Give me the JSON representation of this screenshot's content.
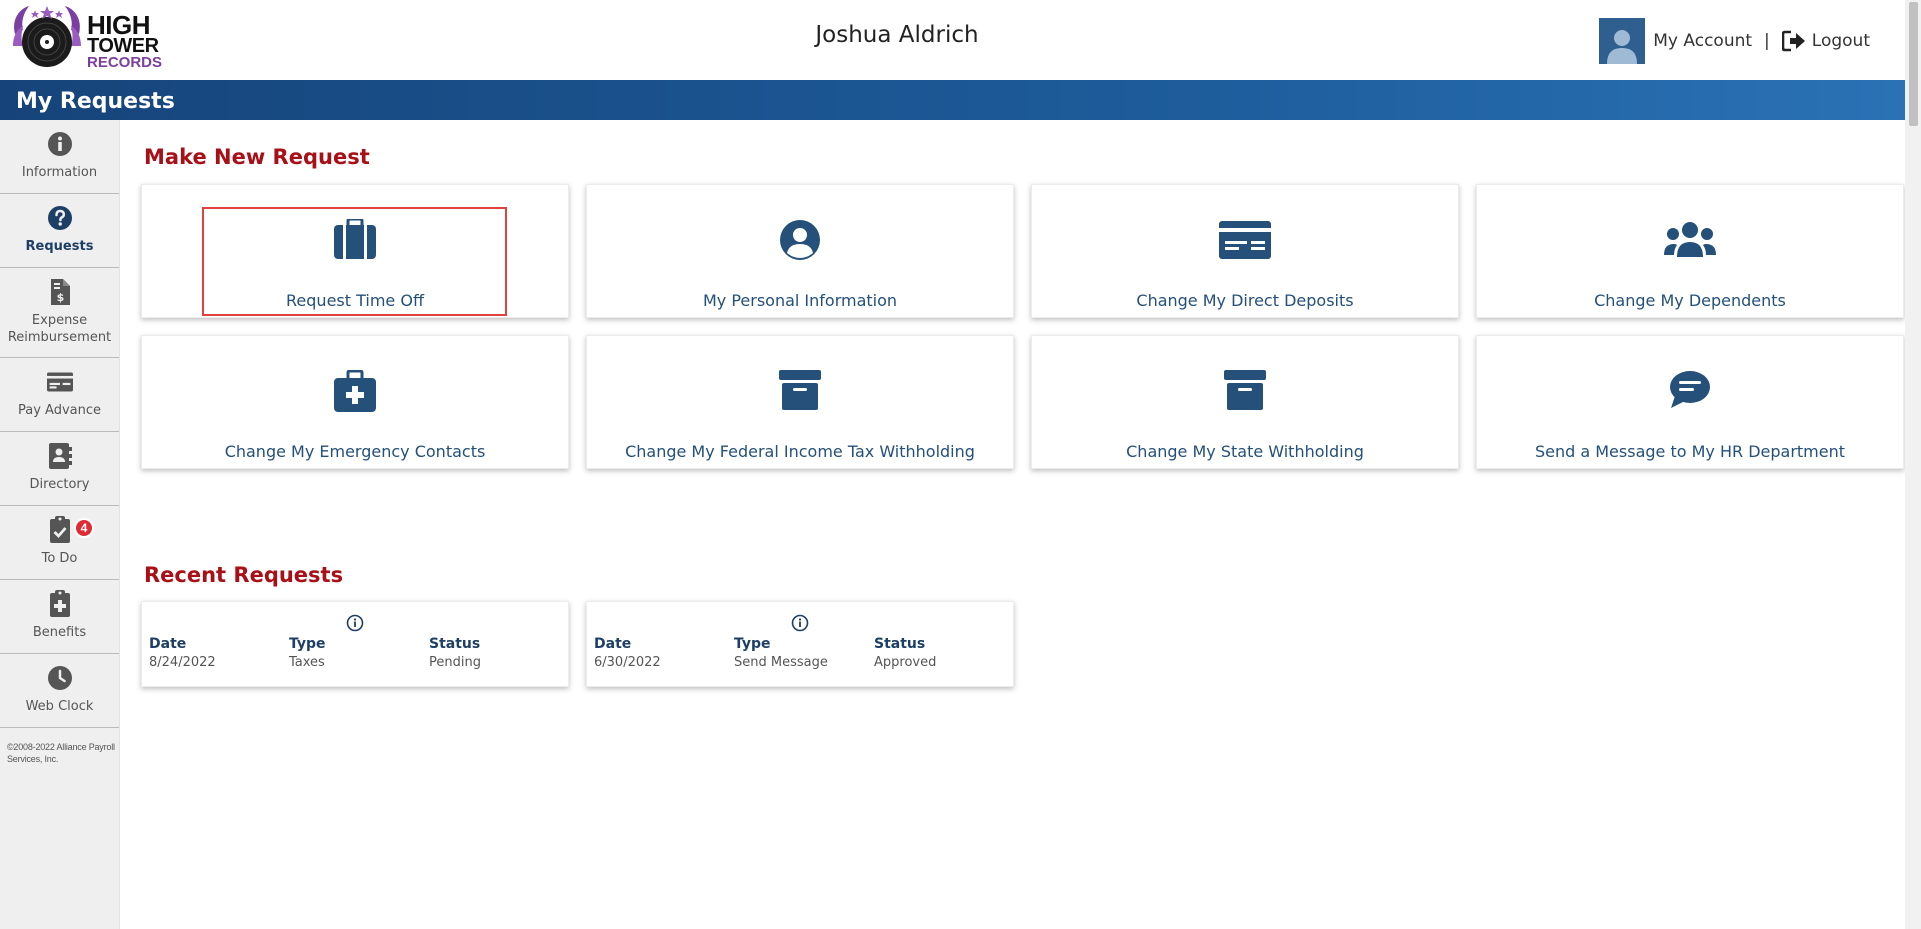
{
  "brand": {
    "line1": "HIGH",
    "line2": "TOWER",
    "line3": "RECORDS",
    "accent": "#7a3fa0"
  },
  "header": {
    "user_name": "Joshua Aldrich",
    "my_account": "My Account",
    "separator": "|",
    "logout": "Logout"
  },
  "page_title": "My Requests",
  "sidebar": {
    "items": [
      {
        "label": "Information",
        "icon": "info-circle-icon"
      },
      {
        "label": "Requests",
        "icon": "question-circle-icon",
        "active": true
      },
      {
        "label": "Expense Reimbursement",
        "icon": "invoice-dollar-icon"
      },
      {
        "label": "Pay Advance",
        "icon": "money-check-icon"
      },
      {
        "label": "Directory",
        "icon": "address-book-icon"
      },
      {
        "label": "To Do",
        "icon": "clipboard-check-icon",
        "badge": "4"
      },
      {
        "label": "Benefits",
        "icon": "clipboard-plus-icon"
      },
      {
        "label": "Web Clock",
        "icon": "clock-icon"
      }
    ],
    "copyright": "©2008-2022 Alliance Payroll Services, Inc."
  },
  "make_new": {
    "title": "Make New Request",
    "cards": [
      {
        "label": "Request Time Off",
        "icon": "suitcase-icon"
      },
      {
        "label": "My Personal Information",
        "icon": "user-circle-icon"
      },
      {
        "label": "Change My Direct Deposits",
        "icon": "money-check-icon"
      },
      {
        "label": "Change My Dependents",
        "icon": "users-icon"
      },
      {
        "label": "Change My Emergency Contacts",
        "icon": "medkit-icon"
      },
      {
        "label": "Change My Federal Income Tax Withholding",
        "icon": "archive-icon"
      },
      {
        "label": "Change My State Withholding",
        "icon": "archive-icon"
      },
      {
        "label": "Send a Message to My HR Department",
        "icon": "comment-icon"
      }
    ]
  },
  "recent": {
    "title": "Recent Requests",
    "headers": {
      "date": "Date",
      "type": "Type",
      "status": "Status"
    },
    "items": [
      {
        "date": "8/24/2022",
        "type": "Taxes",
        "status": "Pending"
      },
      {
        "date": "6/30/2022",
        "type": "Send Message",
        "status": "Approved"
      }
    ]
  },
  "colors": {
    "primary": "#1d3f66",
    "icon": "#24507a",
    "heading_red": "#a80f16",
    "badge_red": "#e02b35",
    "highlight": "#e04040"
  }
}
